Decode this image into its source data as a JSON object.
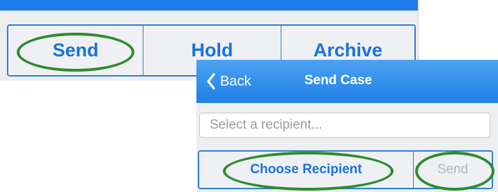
{
  "top_panel": {
    "tabs": [
      {
        "label": "Send"
      },
      {
        "label": "Hold"
      },
      {
        "label": "Archive"
      }
    ]
  },
  "bottom_panel": {
    "nav": {
      "back_label": "Back",
      "title": "Send Case"
    },
    "recipient": {
      "placeholder": "Select a recipient..."
    },
    "actions": {
      "choose_label": "Choose Recipient",
      "send_label": "Send"
    }
  },
  "colors": {
    "accent": "#1a73d9",
    "nav_gradient_top": "#4da3f2",
    "nav_gradient_bottom": "#1f7fe6",
    "highlight": "#2e8b2e",
    "disabled_text": "#b3b5b8"
  },
  "icons": {
    "back": "chevron-left-icon"
  }
}
